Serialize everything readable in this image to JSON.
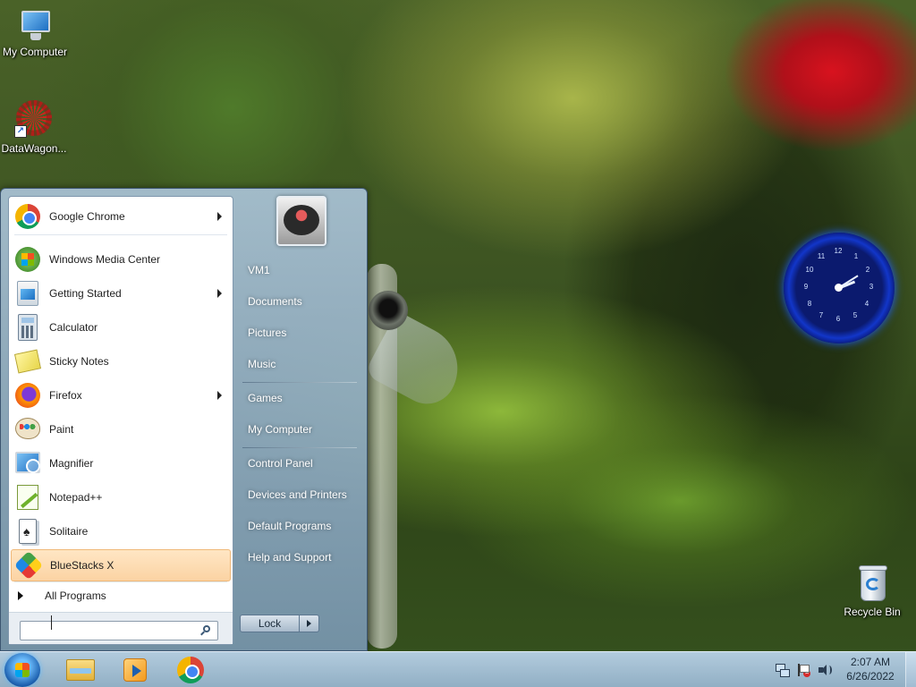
{
  "desktop": {
    "icons": [
      {
        "label": "My Computer",
        "icon": "my-computer-icon"
      },
      {
        "label": "DataWagon...",
        "icon": "datawagon-shortcut-icon"
      },
      {
        "label": "Recycle Bin",
        "icon": "recycle-bin-icon"
      }
    ]
  },
  "clock_gadget": {
    "numbers": [
      "12",
      "1",
      "2",
      "3",
      "4",
      "5",
      "6",
      "7",
      "8",
      "9",
      "10",
      "11"
    ]
  },
  "start_menu": {
    "programs": [
      {
        "label": "Google Chrome",
        "icon": "chrome-icon",
        "has_submenu": true
      },
      {
        "label": "Windows Media Center",
        "icon": "windows-media-center-icon",
        "has_submenu": false
      },
      {
        "label": "Getting Started",
        "icon": "getting-started-icon",
        "has_submenu": true
      },
      {
        "label": "Calculator",
        "icon": "calculator-icon",
        "has_submenu": false
      },
      {
        "label": "Sticky Notes",
        "icon": "sticky-notes-icon",
        "has_submenu": false
      },
      {
        "label": "Firefox",
        "icon": "firefox-icon",
        "has_submenu": true
      },
      {
        "label": "Paint",
        "icon": "paint-icon",
        "has_submenu": false
      },
      {
        "label": "Magnifier",
        "icon": "magnifier-icon",
        "has_submenu": false
      },
      {
        "label": "Notepad++",
        "icon": "notepad-plus-plus-icon",
        "has_submenu": false
      },
      {
        "label": "Solitaire",
        "icon": "solitaire-icon",
        "has_submenu": false
      },
      {
        "label": "BlueStacks X",
        "icon": "bluestacks-icon",
        "has_submenu": false,
        "selected": true
      }
    ],
    "all_programs_label": "All Programs",
    "search": {
      "value": "",
      "placeholder": ""
    },
    "places": [
      "VM1",
      "Documents",
      "Pictures",
      "Music",
      "Games",
      "My Computer",
      "Control Panel",
      "Devices and Printers",
      "Default Programs",
      "Help and Support"
    ],
    "lock_label": "Lock"
  },
  "taskbar": {
    "pinned": [
      {
        "icon": "windows-explorer-icon"
      },
      {
        "icon": "windows-media-player-icon"
      },
      {
        "icon": "chrome-icon"
      }
    ],
    "tray_icons": [
      "network-icon",
      "action-center-flag-icon",
      "speaker-icon"
    ],
    "time": "2:07 AM",
    "date": "6/26/2022"
  },
  "colors": {
    "selected_item_bg": "#fbd3a3",
    "taskbar_bg": "#a9c4dc",
    "start_menu_right_pane": "#8fa8bf",
    "clock_gadget_blue": "#1236c9"
  }
}
